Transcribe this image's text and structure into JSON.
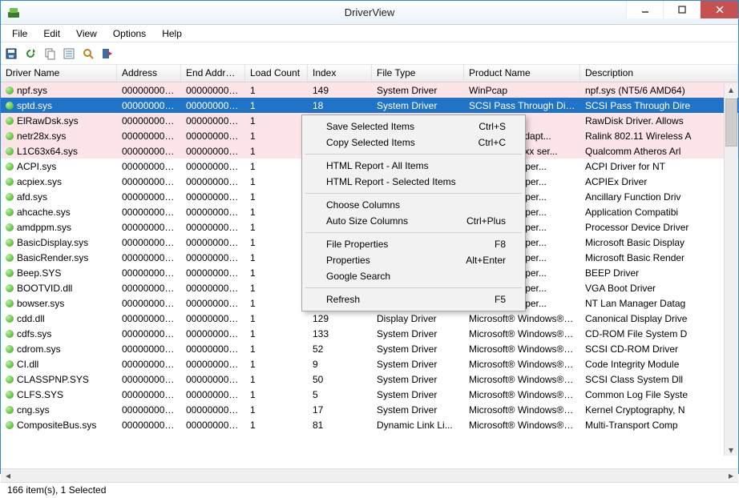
{
  "window": {
    "title": "DriverView"
  },
  "menu": {
    "file": "File",
    "edit": "Edit",
    "view": "View",
    "options": "Options",
    "help": "Help"
  },
  "columns": [
    "Driver Name",
    "Address",
    "End Address",
    "Load Count",
    "Index",
    "File Type",
    "Product Name",
    "Description"
  ],
  "rows": [
    {
      "pink": true,
      "name": "npf.sys",
      "addr": "00000000`0...",
      "end": "00000000`0...",
      "lc": "1",
      "idx": "149",
      "ft": "System Driver",
      "pn": "WinPcap",
      "desc": "npf.sys (NT5/6 AMD64)"
    },
    {
      "sel": true,
      "name": "sptd.sys",
      "addr": "00000000`0...",
      "end": "00000000`0...",
      "lc": "1",
      "idx": "18",
      "ft": "System Driver",
      "pn": "SCSI Pass Through Direct",
      "desc": "SCSI Pass Through Dire"
    },
    {
      "pink": true,
      "name": "ElRawDsk.sys",
      "addr": "00000000`0...",
      "end": "00000000`0...",
      "lc": "1",
      "idx": "",
      "ft": "",
      "pn": "",
      "desc": "RawDisk Driver. Allows"
    },
    {
      "pink": true,
      "name": "netr28x.sys",
      "addr": "00000000`0...",
      "end": "00000000`0...",
      "lc": "1",
      "idx": "",
      "ft": "",
      "pn": "ln Wireless Adapt...",
      "desc": "Ralink 802.11 Wireless A"
    },
    {
      "pink": true,
      "name": "L1C63x64.sys",
      "addr": "00000000`0...",
      "end": "00000000`0...",
      "lc": "1",
      "idx": "",
      "ft": "",
      "pn": "Atheros Ar81xx ser...",
      "desc": "Qualcomm Atheros Arl"
    },
    {
      "name": "ACPI.sys",
      "addr": "00000000`0...",
      "end": "00000000`0...",
      "lc": "1",
      "idx": "",
      "ft": "",
      "pn": "Windows® Oper...",
      "desc": "ACPI Driver for NT"
    },
    {
      "name": "acpiex.sys",
      "addr": "00000000`0...",
      "end": "00000000`0...",
      "lc": "1",
      "idx": "",
      "ft": "",
      "pn": "Windows® Oper...",
      "desc": "ACPIEx Driver"
    },
    {
      "name": "afd.sys",
      "addr": "00000000`0...",
      "end": "00000000`0...",
      "lc": "1",
      "idx": "",
      "ft": "",
      "pn": "Windows® Oper...",
      "desc": "Ancillary Function Driv"
    },
    {
      "name": "ahcache.sys",
      "addr": "00000000`0...",
      "end": "00000000`0...",
      "lc": "1",
      "idx": "",
      "ft": "",
      "pn": "Windows® Oper...",
      "desc": "Application Compatibi"
    },
    {
      "name": "amdppm.sys",
      "addr": "00000000`0...",
      "end": "00000000`0...",
      "lc": "1",
      "idx": "",
      "ft": "",
      "pn": "Windows® Oper...",
      "desc": "Processor Device Driver"
    },
    {
      "name": "BasicDisplay.sys",
      "addr": "00000000`0...",
      "end": "00000000`0...",
      "lc": "1",
      "idx": "",
      "ft": "",
      "pn": "Windows® Oper...",
      "desc": "Microsoft Basic Display"
    },
    {
      "name": "BasicRender.sys",
      "addr": "00000000`0...",
      "end": "00000000`0...",
      "lc": "1",
      "idx": "",
      "ft": "",
      "pn": "Windows® Oper...",
      "desc": "Microsoft Basic Render"
    },
    {
      "name": "Beep.SYS",
      "addr": "00000000`0...",
      "end": "00000000`0...",
      "lc": "1",
      "idx": "",
      "ft": "",
      "pn": "Windows® Oper...",
      "desc": "BEEP Driver"
    },
    {
      "name": "BOOTVID.dll",
      "addr": "00000000`0...",
      "end": "00000000`0...",
      "lc": "1",
      "idx": "",
      "ft": "",
      "pn": "Windows® Oper...",
      "desc": "VGA Boot Driver"
    },
    {
      "name": "bowser.sys",
      "addr": "00000000`0...",
      "end": "00000000`0...",
      "lc": "1",
      "idx": "",
      "ft": "",
      "pn": "Windows® Oper...",
      "desc": "NT Lan Manager Datag"
    },
    {
      "name": "cdd.dll",
      "addr": "00000000`0...",
      "end": "00000000`0...",
      "lc": "1",
      "idx": "129",
      "ft": "Display Driver",
      "pn": "Microsoft® Windows® Oper...",
      "desc": "Canonical Display Drive"
    },
    {
      "name": "cdfs.sys",
      "addr": "00000000`0...",
      "end": "00000000`0...",
      "lc": "1",
      "idx": "133",
      "ft": "System Driver",
      "pn": "Microsoft® Windows® Oper...",
      "desc": "CD-ROM File System D"
    },
    {
      "name": "cdrom.sys",
      "addr": "00000000`0...",
      "end": "00000000`0...",
      "lc": "1",
      "idx": "52",
      "ft": "System Driver",
      "pn": "Microsoft® Windows® Oper...",
      "desc": "SCSI CD-ROM Driver"
    },
    {
      "name": "CI.dll",
      "addr": "00000000`0...",
      "end": "00000000`0...",
      "lc": "1",
      "idx": "9",
      "ft": "System Driver",
      "pn": "Microsoft® Windows® Oper...",
      "desc": "Code Integrity Module"
    },
    {
      "name": "CLASSPNP.SYS",
      "addr": "00000000`0...",
      "end": "00000000`0...",
      "lc": "1",
      "idx": "50",
      "ft": "System Driver",
      "pn": "Microsoft® Windows® Oper...",
      "desc": "SCSI Class System Dll"
    },
    {
      "name": "CLFS.SYS",
      "addr": "00000000`0...",
      "end": "00000000`0...",
      "lc": "1",
      "idx": "5",
      "ft": "System Driver",
      "pn": "Microsoft® Windows® Oper...",
      "desc": "Common Log File Syste"
    },
    {
      "name": "cng.sys",
      "addr": "00000000`0...",
      "end": "00000000`0...",
      "lc": "1",
      "idx": "17",
      "ft": "System Driver",
      "pn": "Microsoft® Windows® Oper...",
      "desc": "Kernel Cryptography, N"
    },
    {
      "name": "CompositeBus.sys",
      "addr": "00000000`0...",
      "end": "00000000`0...",
      "lc": "1",
      "idx": "81",
      "ft": "Dynamic Link Li...",
      "pn": "Microsoft® Windows® Oper...",
      "desc": "Multi-Transport Comp"
    }
  ],
  "context": [
    {
      "label": "Save Selected Items",
      "shortcut": "Ctrl+S"
    },
    {
      "label": "Copy Selected Items",
      "shortcut": "Ctrl+C"
    },
    {
      "sep": true
    },
    {
      "label": "HTML Report - All Items",
      "shortcut": ""
    },
    {
      "label": "HTML Report - Selected Items",
      "shortcut": ""
    },
    {
      "sep": true
    },
    {
      "label": "Choose Columns",
      "shortcut": ""
    },
    {
      "label": "Auto Size Columns",
      "shortcut": "Ctrl+Plus"
    },
    {
      "sep": true
    },
    {
      "label": "File Properties",
      "shortcut": "F8"
    },
    {
      "label": "Properties",
      "shortcut": "Alt+Enter"
    },
    {
      "label": "Google Search",
      "shortcut": ""
    },
    {
      "sep": true
    },
    {
      "label": "Refresh",
      "shortcut": "F5"
    }
  ],
  "status": "166 item(s), 1 Selected"
}
